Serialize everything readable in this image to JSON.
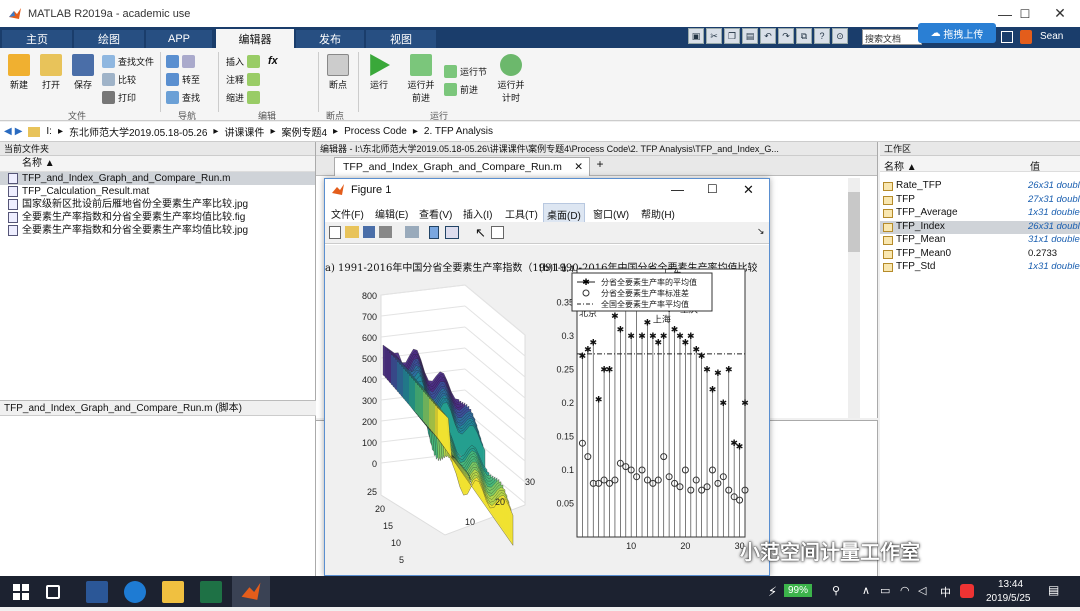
{
  "window": {
    "title": "MATLAB R2019a - academic use",
    "min": "—",
    "max": "☐",
    "close": "✕"
  },
  "tabs": [
    "主页",
    "绘图",
    "APP",
    "编辑器",
    "发布",
    "视图"
  ],
  "search_doc": "搜索文档",
  "drag_upload": "拖拽上传",
  "user": "Sean",
  "ribbon": {
    "new": "新建",
    "open": "打开",
    "save": "保存",
    "find_file": "查找文件",
    "compare": "比较",
    "print": "打印",
    "goto": "转至",
    "find": "查找",
    "insert": "插入",
    "comment": "注释",
    "indent": "缩进",
    "fx": "fx",
    "breakpoint": "断点",
    "run": "运行",
    "run_advance": "运行并\n前进",
    "run_section": "运行节",
    "advance": "前进",
    "run_time": "运行并\n计时",
    "sec_file": "文件",
    "sec_nav": "导航",
    "sec_edit": "编辑",
    "sec_bp": "断点",
    "sec_run": "运行"
  },
  "address": {
    "drive": "I:",
    "crumbs": [
      "东北师范大学2019.05.18-05.26",
      "讲课课件",
      "案例专题4",
      "Process Code",
      "2. TFP Analysis"
    ]
  },
  "current_folder": {
    "title": "当前文件夹",
    "col": "名称 ▲",
    "files": [
      "TFP_and_Index_Graph_and_Compare_Run.m",
      "TFP_Calculation_Result.mat",
      "国家级新区批设前后雁地省份全要素生产率比较.jpg",
      "全要素生产率指数和分省全要素生产率均值比较.fig",
      "全要素生产率指数和分省全要素生产率均值比较.jpg"
    ],
    "detail": "TFP_and_Index_Graph_and_Compare_Run.m  (脚本)"
  },
  "editor": {
    "title": "编辑器 - I:\\东北师范大学2019.05.18-05.26\\讲课课件\\案例专题4\\Process Code\\2. TFP Analysis\\TFP_and_Index_G...",
    "tab": "TFP_and_Index_Graph_and_Compare_Run.m",
    "plus": "+"
  },
  "figure": {
    "title": "Figure 1",
    "menu": [
      "文件(F)",
      "编辑(E)",
      "查看(V)",
      "插入(I)",
      "工具(T)",
      "桌面(D)",
      "窗口(W)",
      "帮助(H)"
    ],
    "left_title": "a) 1991-2016年中国分省全要素生产率指数（1991-1",
    "right_title": "(b)1990-2016年中国分省全要素生产率均值比较",
    "legend": [
      "分省全要素生产率的平均值",
      "分省全要素生产率标准差",
      "全国全要素生产率平均值"
    ],
    "left_zticks": [
      "800",
      "700",
      "600",
      "500",
      "400",
      "300",
      "200",
      "100",
      "0"
    ],
    "left_yticks": [
      "25",
      "20",
      "15",
      "10",
      "5"
    ],
    "left_xticks": [
      "10",
      "20",
      "30"
    ],
    "right_yticks": [
      "0.4",
      "0.35",
      "0.3",
      "0.25",
      "0.2",
      "0.15",
      "0.1",
      "0.05"
    ],
    "right_xticks": [
      "10",
      "20",
      "30"
    ],
    "labels": [
      "北京",
      "广东",
      "重庆",
      "天津",
      "上海"
    ]
  },
  "workspace": {
    "title": "工作区",
    "col_name": "名称 ▲",
    "col_val": "值",
    "vars": [
      {
        "name": "Rate_TFP",
        "value": "26x31 double"
      },
      {
        "name": "TFP",
        "value": "27x31 double"
      },
      {
        "name": "TFP_Average",
        "value": "1x31 double"
      },
      {
        "name": "TFP_Index",
        "value": "26x31 double"
      },
      {
        "name": "TFP_Mean",
        "value": "31x1 double"
      },
      {
        "name": "TFP_Mean0",
        "value": "0.2733"
      },
      {
        "name": "TFP_Std",
        "value": "1x31 double"
      }
    ]
  },
  "chart_data": [
    {
      "type": "surface",
      "title": "a) 1991-2016年中国分省全要素生产率指数（1991-1",
      "zlim": [
        0,
        800
      ],
      "ylim": [
        0,
        27
      ],
      "xlim": [
        0,
        31
      ]
    },
    {
      "type": "scatter",
      "title": "(b)1990-2016年中国分省全要素生产率均值比较",
      "xlim": [
        0,
        31
      ],
      "ylim": [
        0,
        0.4
      ],
      "series": [
        {
          "name": "分省全要素生产率的平均值",
          "x": [
            1,
            2,
            3,
            4,
            5,
            6,
            7,
            8,
            9,
            10,
            11,
            12,
            13,
            14,
            15,
            16,
            17,
            18,
            19,
            20,
            21,
            22,
            23,
            24,
            25,
            26,
            27,
            28,
            29,
            30,
            31
          ],
          "values": [
            0.27,
            0.28,
            0.29,
            0.205,
            0.25,
            0.25,
            0.33,
            0.31,
            0.36,
            0.3,
            0.35,
            0.3,
            0.32,
            0.3,
            0.29,
            0.3,
            0.34,
            0.31,
            0.3,
            0.29,
            0.3,
            0.28,
            0.27,
            0.25,
            0.22,
            0.245,
            0.2,
            0.25,
            0.14,
            0.135,
            0.2
          ]
        },
        {
          "name": "分省全要素生产率标准差",
          "x": [
            1,
            2,
            3,
            4,
            5,
            6,
            7,
            8,
            9,
            10,
            11,
            12,
            13,
            14,
            15,
            16,
            17,
            18,
            19,
            20,
            21,
            22,
            23,
            24,
            25,
            26,
            27,
            28,
            29,
            30,
            31
          ],
          "values": [
            0.14,
            0.12,
            0.08,
            0.08,
            0.085,
            0.08,
            0.085,
            0.11,
            0.105,
            0.1,
            0.09,
            0.1,
            0.085,
            0.08,
            0.085,
            0.12,
            0.09,
            0.08,
            0.075,
            0.1,
            0.07,
            0.085,
            0.07,
            0.075,
            0.1,
            0.08,
            0.09,
            0.07,
            0.06,
            0.055,
            0.07
          ]
        }
      ],
      "reference": {
        "name": "全国全要素生产率平均值",
        "value": 0.2733
      }
    }
  ],
  "taskbar": {
    "battery": "99%",
    "ime": "中",
    "time": "13:44",
    "date": "2019/5/25"
  },
  "watermark": "小范空间计量工作室"
}
